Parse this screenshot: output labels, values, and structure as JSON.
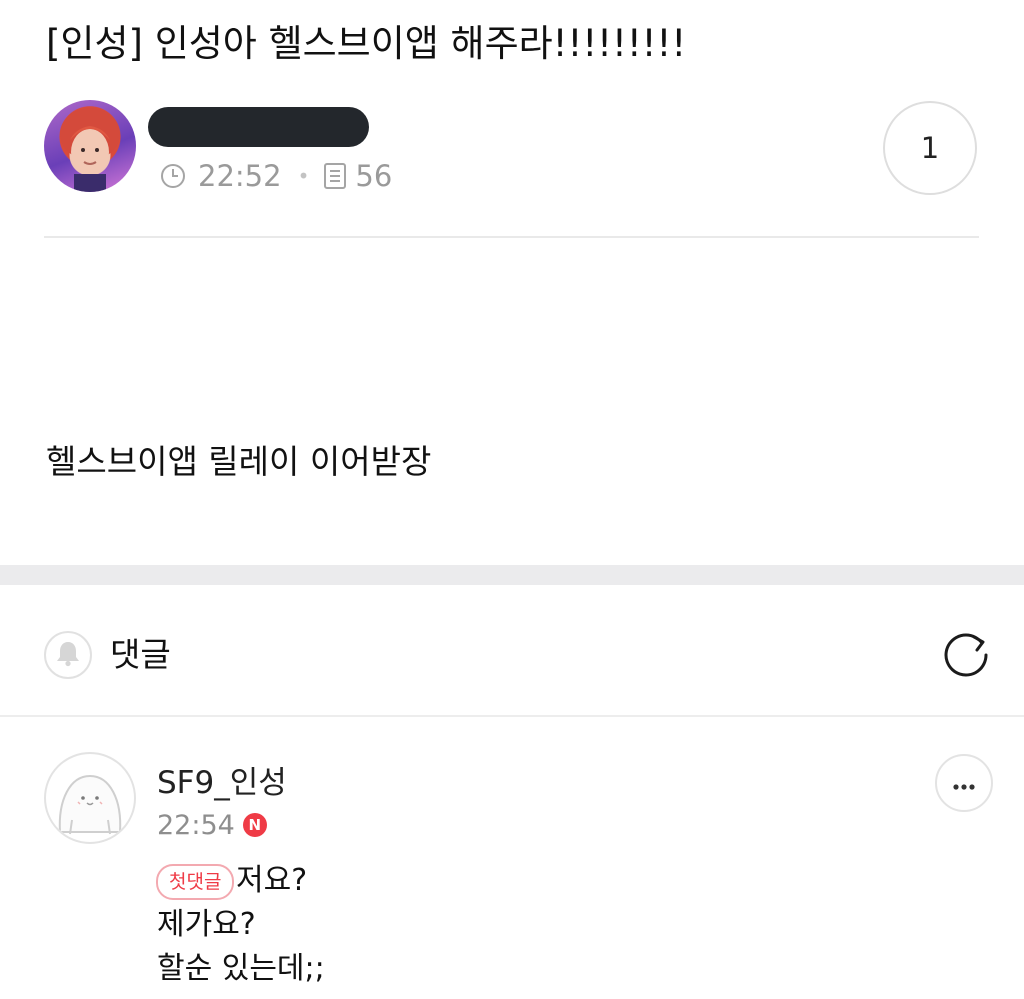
{
  "post": {
    "title": "[인성] 인성아 헬스브이앱 해주라!!!!!!!!!",
    "time": "22:52",
    "views": "56",
    "like_count": "1",
    "body": "헬스브이앱 릴레이 이어받장"
  },
  "comments_section": {
    "title": "댓글"
  },
  "comment": {
    "author": "SF9_인성",
    "time": "22:54",
    "new_badge": "N",
    "first_badge": "첫댓글",
    "lines": [
      "저요?",
      "제가요?",
      "할순 있는데;;"
    ]
  },
  "icons": {
    "time": "clock-icon",
    "views": "document-icon",
    "notify": "bell-icon",
    "refresh": "refresh-icon",
    "more": "more-icon"
  },
  "colors": {
    "accent_red": "#ef3b46",
    "redacted": "#23272c",
    "meta_gray": "#9a9a9a"
  }
}
